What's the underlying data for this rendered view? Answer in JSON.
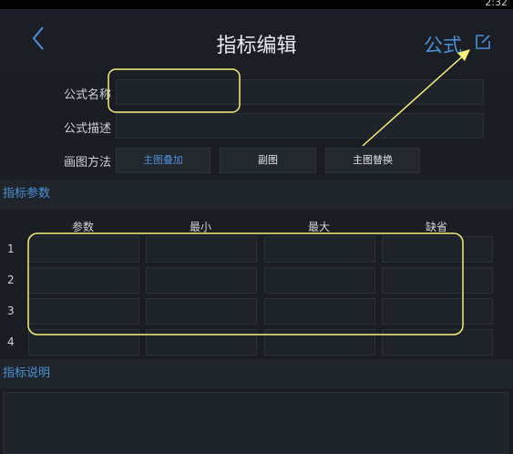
{
  "status": {
    "time": "2:32"
  },
  "header": {
    "title": "指标编辑",
    "action_label": "公式"
  },
  "form": {
    "name_label": "公式名称",
    "desc_label": "公式描述",
    "draw_label": "画图方法",
    "draw_options": [
      "主图叠加",
      "副图",
      "主图替换"
    ],
    "selected_option": "主图叠加"
  },
  "params": {
    "section_title": "指标参数",
    "columns": [
      "参数",
      "最小",
      "最大",
      "缺省"
    ],
    "rows": [
      "1",
      "2",
      "3",
      "4"
    ]
  },
  "description": {
    "section_title": "指标说明"
  },
  "colors": {
    "accent": "#4a90d9",
    "annotation": "#f5f07a",
    "background": "#1a1d22"
  }
}
